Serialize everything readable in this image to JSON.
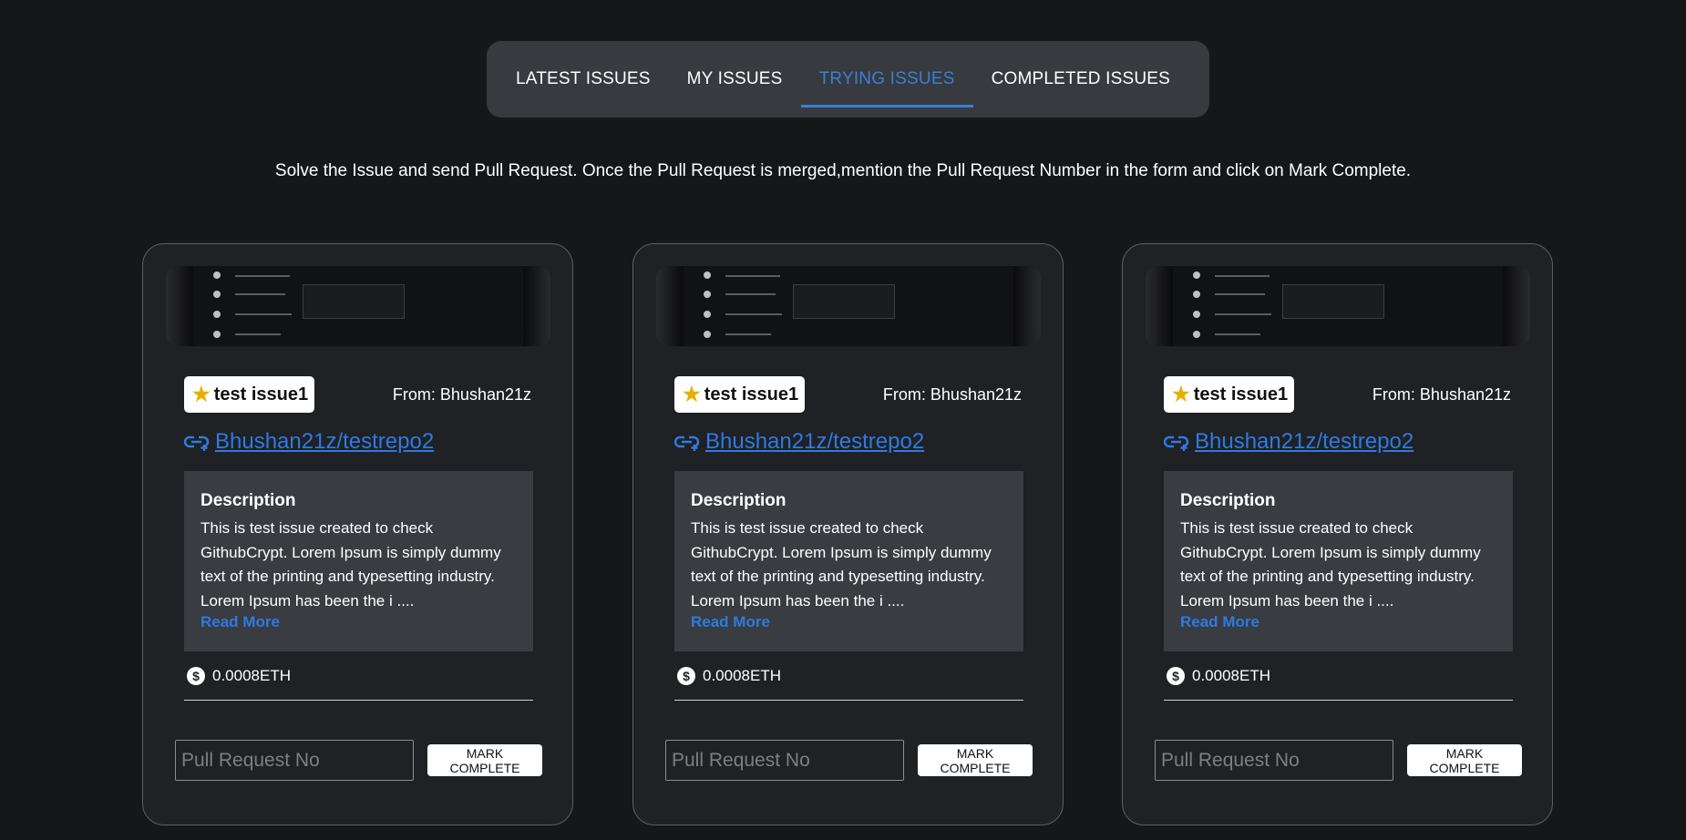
{
  "tabs": [
    {
      "label": "LATEST ISSUES"
    },
    {
      "label": "MY ISSUES"
    },
    {
      "label": "TRYING ISSUES"
    },
    {
      "label": "COMPLETED ISSUES"
    }
  ],
  "active_tab": "TRYING ISSUES",
  "instructions": "Solve the Issue and send Pull Request. Once the Pull Request is merged,mention the Pull Request Number in the form and click on Mark Complete.",
  "cards": [
    {
      "title": "test issue1",
      "from": "From: Bhushan21z",
      "repo": "Bhushan21z/testrepo2",
      "desc_heading": "Description",
      "desc_text": "This is test issue created to check GithubCrypt. Lorem Ipsum is simply dummy text of the printing and typesetting industry. Lorem Ipsum has been the i ....",
      "read_more": "Read More",
      "price": "0.0008ETH",
      "pr_placeholder": "Pull Request No",
      "button_label": "MARK COMPLETE"
    },
    {
      "title": "test issue1",
      "from": "From: Bhushan21z",
      "repo": "Bhushan21z/testrepo2",
      "desc_heading": "Description",
      "desc_text": "This is test issue created to check GithubCrypt. Lorem Ipsum is simply dummy text of the printing and typesetting industry. Lorem Ipsum has been the i ....",
      "read_more": "Read More",
      "price": "0.0008ETH",
      "pr_placeholder": "Pull Request No",
      "button_label": "MARK COMPLETE"
    },
    {
      "title": "test issue1",
      "from": "From: Bhushan21z",
      "repo": "Bhushan21z/testrepo2",
      "desc_heading": "Description",
      "desc_text": "This is test issue created to check GithubCrypt. Lorem Ipsum is simply dummy text of the printing and typesetting industry. Lorem Ipsum has been the i ....",
      "read_more": "Read More",
      "price": "0.0008ETH",
      "pr_placeholder": "Pull Request No",
      "button_label": "MARK COMPLETE"
    }
  ],
  "colors": {
    "background": "#161719",
    "accent": "#3a7fd6",
    "card": "#1f2125",
    "desc_box": "#393c40",
    "star": "#e6b000"
  },
  "icons": {
    "title_icon": "star-icon",
    "repo_icon": "link-icon",
    "price_icon": "dollar-coin-icon"
  }
}
